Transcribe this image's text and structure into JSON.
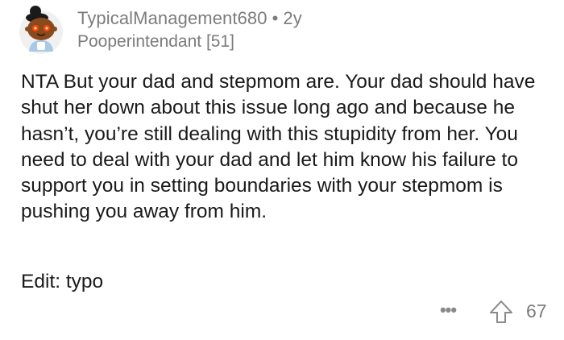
{
  "comment": {
    "author": {
      "username": "TypicalManagement680",
      "separator": "•",
      "age": "2y",
      "flair": "Pooperintendant [51]",
      "avatar_icon": "snoo-avatar-icon"
    },
    "body": "NTA But your dad and stepmom are. Your dad should have shut her down about this issue long ago and because he hasn’t, you’re still dealing with this stupidity from her. You need to deal with your dad and let him know his failure to support you in setting boundaries with your stepmom is pushing you away from him.",
    "edit": "Edit: typo",
    "actions": {
      "more_label": "•••",
      "upvote_icon": "upvote-arrow-icon",
      "vote_count": "67"
    },
    "colors": {
      "text": "#1a1a1b",
      "meta": "#7c7c7c",
      "avatar_skin": "#8a4a1f",
      "avatar_eyes": "#ff4500",
      "avatar_bg": "#f0f0f0"
    }
  }
}
